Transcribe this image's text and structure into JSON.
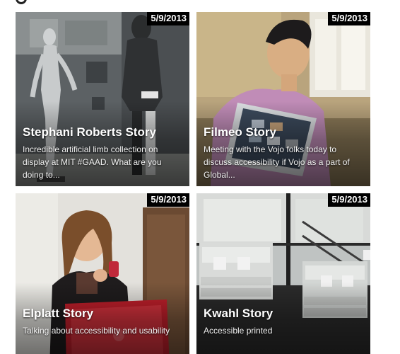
{
  "stories": [
    {
      "date": "5/9/2013",
      "title": "Stephani Roberts Story",
      "description": "Incredible artificial limb collection on display at MIT #GAAD. What are you doing to..."
    },
    {
      "date": "5/9/2013",
      "title": "Filmeo Story",
      "description": "Meeting with the Vojo folks today to discuss accessibility if Vojo as a part of Global..."
    },
    {
      "date": "5/9/2013",
      "title": "Elplatt Story",
      "description": "Talking about accessibility and usability"
    },
    {
      "date": "5/9/2013",
      "title": "Kwahl Story",
      "description": "Accessible printed"
    }
  ]
}
